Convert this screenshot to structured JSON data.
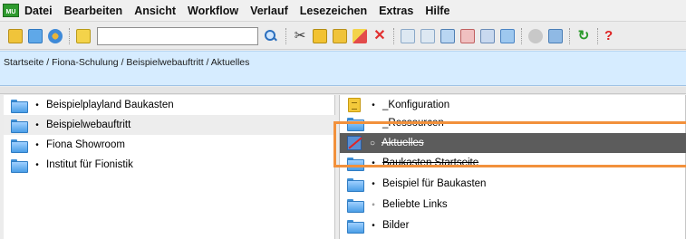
{
  "app": {
    "logo_text": "MU"
  },
  "menu": [
    "Datei",
    "Bearbeiten",
    "Ansicht",
    "Workflow",
    "Verlauf",
    "Lesezeichen",
    "Extras",
    "Hilfe"
  ],
  "search": {
    "value": "",
    "placeholder": ""
  },
  "breadcrumb": "Startseite / Fiona-Schulung / Beispielwebauftritt / Aktuelles",
  "left_tree": [
    {
      "label": "Beispielplayland Baukasten",
      "bullet": "•"
    },
    {
      "label": "Beispielwebauftritt",
      "bullet": "•"
    },
    {
      "label": "Fiona Showroom",
      "bullet": "•"
    },
    {
      "label": "Institut für Fionistik",
      "bullet": "•"
    }
  ],
  "right_list": [
    {
      "label": "_Konfiguration",
      "bullet": "•",
      "icon": "document-icon"
    },
    {
      "label": "_Ressourcen",
      "bullet": "•",
      "icon": "folder-icon"
    },
    {
      "label": "Aktuelles",
      "bullet": "○",
      "icon": "deleted-document-icon"
    },
    {
      "label": "Baukasten Startseite",
      "bullet": "•",
      "icon": "folder-icon"
    },
    {
      "label": "Beispiel für Baukasten",
      "bullet": "•",
      "icon": "folder-icon"
    },
    {
      "label": "Beliebte Links",
      "bullet": "◦",
      "icon": "folder-icon"
    },
    {
      "label": "Bilder",
      "bullet": "•",
      "icon": "folder-icon"
    }
  ],
  "colors": {
    "highlight_frame": "#f2913c",
    "breadcrumb_bg": "#d6ecff",
    "selected_row": "#5c5c5c"
  }
}
